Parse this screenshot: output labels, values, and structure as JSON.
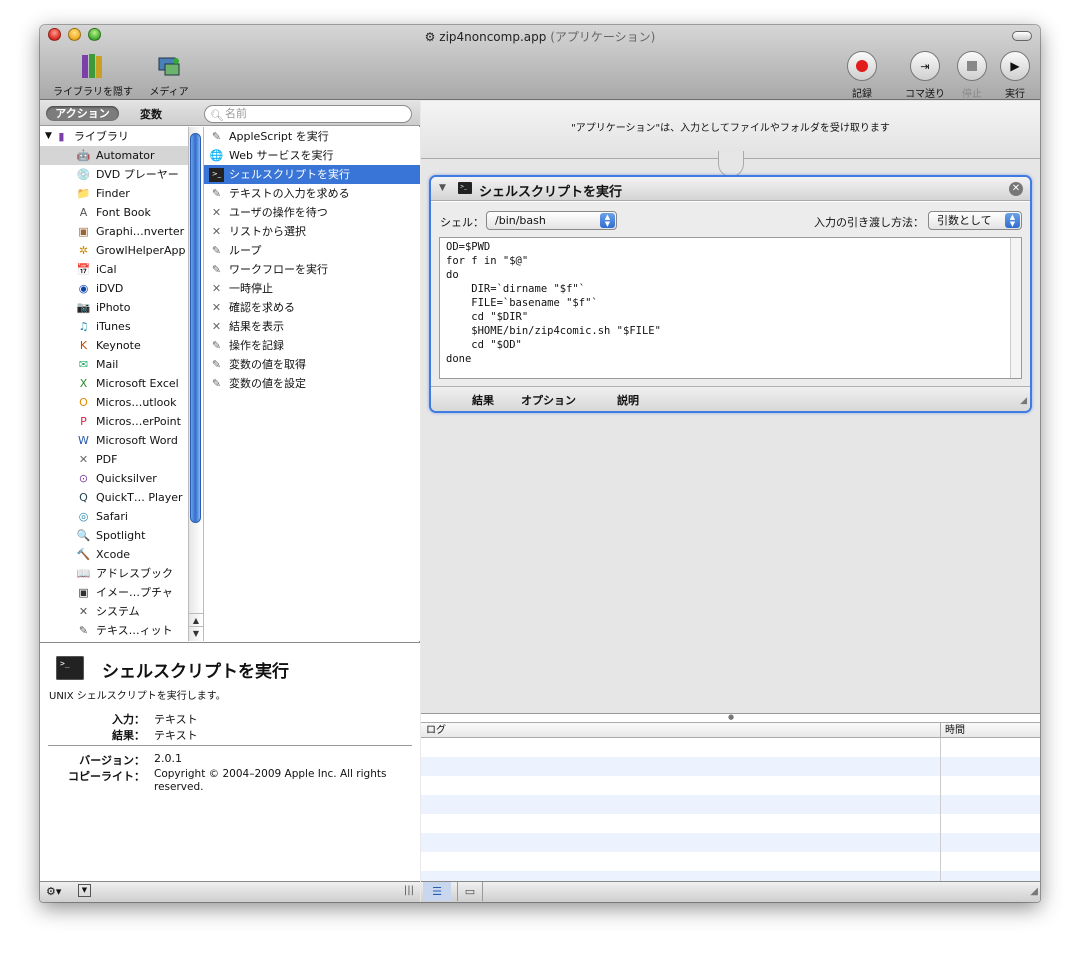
{
  "window": {
    "title": "zip4noncomp.app",
    "title_sub": "(アプリケーション)"
  },
  "toolbar": {
    "hide_library": "ライブラリを隠す",
    "media": "メディア",
    "record": "記録",
    "step": "コマ送り",
    "stop": "停止",
    "run": "実行"
  },
  "sidebar": {
    "tab_actions": "アクション",
    "tab_variables": "変数",
    "search_placeholder": "名前",
    "library_label": "ライブラリ",
    "categories": [
      "Automator",
      "DVD プレーヤー",
      "Finder",
      "Font Book",
      "Graphi…nverter",
      "GrowlHelperApp",
      "iCal",
      "iDVD",
      "iPhoto",
      "iTunes",
      "Keynote",
      "Mail",
      "Microsoft Excel",
      "Micros…utlook",
      "Micros…erPoint",
      "Microsoft Word",
      "PDF",
      "Quicksilver",
      "QuickT… Player",
      "Safari",
      "Spotlight",
      "Xcode",
      "アドレスブック",
      "イメー…プチャ",
      "システム",
      "テキス…ィット"
    ],
    "actions": [
      "AppleScript を実行",
      "Web サービスを実行",
      "シェルスクリプトを実行",
      "テキストの入力を求める",
      "ユーザの操作を待つ",
      "リストから選択",
      "ループ",
      "ワークフローを実行",
      "一時停止",
      "確認を求める",
      "結果を表示",
      "操作を記録",
      "変数の値を取得",
      "変数の値を設定"
    ]
  },
  "description": {
    "title": "シェルスクリプトを実行",
    "text": "UNIX シェルスクリプトを実行します。",
    "input_label": "入力：",
    "input_value": "テキスト",
    "result_label": "結果：",
    "result_value": "テキスト",
    "version_label": "バージョン：",
    "version_value": "2.0.1",
    "copyright_label": "コピーライト：",
    "copyright_value": "Copyright © 2004–2009 Apple Inc.  All rights reserved."
  },
  "workflow": {
    "input_info": "\"アプリケーション\"は、入力としてファイルやフォルダを受け取ります",
    "card_title": "シェルスクリプトを実行",
    "shell_label": "シェル：",
    "shell_value": "/bin/bash",
    "pass_input_label": "入力の引き渡し方法：",
    "pass_input_value": "引数として",
    "script": "OD=$PWD\nfor f in \"$@\"\ndo\n    DIR=`dirname \"$f\"`\n    FILE=`basename \"$f\"`\n    cd \"$DIR\"\n    $HOME/bin/zip4comic.sh \"$FILE\"\n    cd \"$OD\"\ndone",
    "tab_results": "結果",
    "tab_options": "オプション",
    "tab_description": "説明"
  },
  "log": {
    "col_log": "ログ",
    "col_time": "時間"
  }
}
